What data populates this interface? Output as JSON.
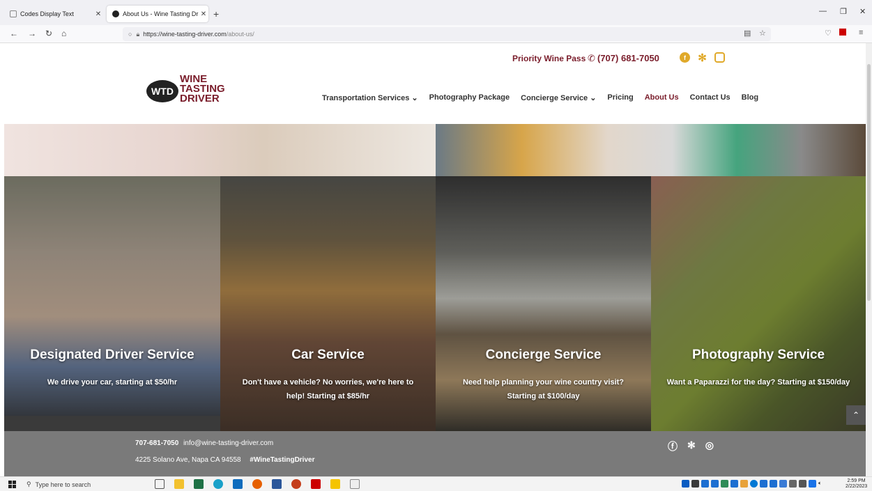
{
  "browser": {
    "tabs": [
      {
        "title": "Codes Display Text"
      },
      {
        "title": "About Us - Wine Tasting Driver"
      }
    ],
    "url_host": "https://wine-tasting-driver.com",
    "url_path": "/about-us/"
  },
  "topbar": {
    "pass_link": "Priority Wine Pass",
    "phone": "(707) 681-7050"
  },
  "logo": {
    "mark": "WTD",
    "word1": "WINE",
    "word2": "TASTING",
    "word3": "DRIVER"
  },
  "nav": {
    "items": [
      {
        "label": "Transportation Services ⌄"
      },
      {
        "label": "Photography Package"
      },
      {
        "label": "Concierge Service ⌄"
      },
      {
        "label": "Pricing"
      },
      {
        "label": "About Us"
      },
      {
        "label": "Contact Us"
      },
      {
        "label": "Blog"
      }
    ]
  },
  "services": [
    {
      "title": "Designated Driver Service",
      "desc": "We drive your car, starting at $50/hr"
    },
    {
      "title": "Car Service",
      "desc": "Don't have a vehicle? No worries, we're here to help! Starting at $85/hr"
    },
    {
      "title": "Concierge Service",
      "desc": "Need help planning your wine country visit? Starting at $100/day"
    },
    {
      "title": "Photography Service",
      "desc": "Want a Paparazzi for the day? Starting at $150/day"
    }
  ],
  "footer": {
    "phone": "707-681-7050",
    "email": "info@wine-tasting-driver.com",
    "address": "4225 Solano Ave, Napa CA 94558",
    "hashtag": "#WineTastingDriver"
  },
  "taskbar": {
    "search_placeholder": "Type here to search",
    "time": "2:59 PM",
    "date": "2/22/2023"
  },
  "colors": {
    "brand": "#7a1d2b",
    "footer": "#7a7a7a"
  }
}
